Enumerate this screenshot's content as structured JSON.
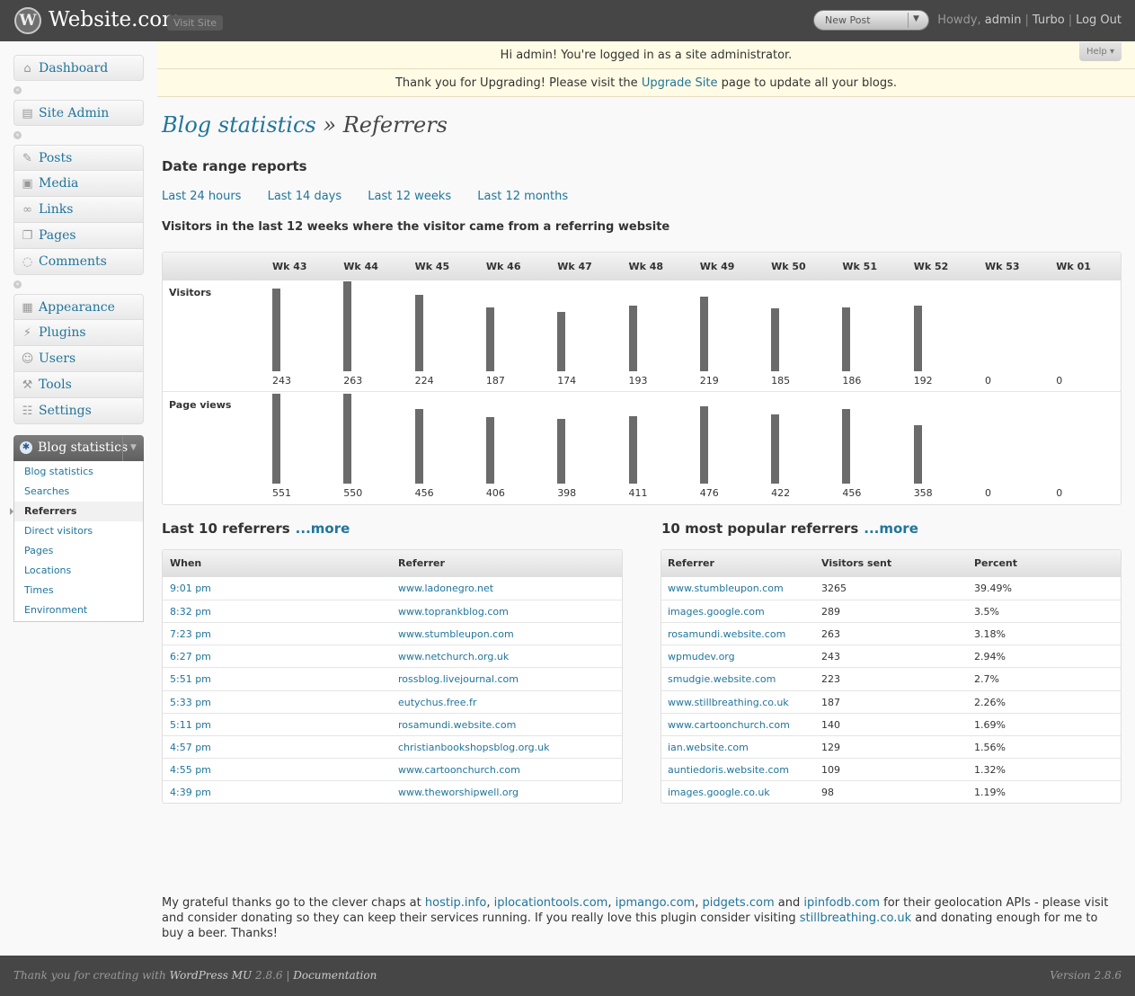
{
  "header": {
    "site_title": "Website.com",
    "visit_site": "Visit Site",
    "new_post": "New Post",
    "howdy": "Howdy,",
    "user": "admin",
    "turbo": "Turbo",
    "logout": "Log Out"
  },
  "notices": {
    "admin": "Hi admin! You're logged in as a site administrator.",
    "help": "Help",
    "upgrade_pre": "Thank you for Upgrading! Please visit the",
    "upgrade_link": "Upgrade Site",
    "upgrade_post": "page to update all your blogs."
  },
  "menu": {
    "dashboard": "Dashboard",
    "site_admin": "Site Admin",
    "posts": "Posts",
    "media": "Media",
    "links": "Links",
    "pages": "Pages",
    "comments": "Comments",
    "appearance": "Appearance",
    "plugins": "Plugins",
    "users": "Users",
    "tools": "Tools",
    "settings": "Settings",
    "blog_statistics": "Blog statistics",
    "submenu": [
      "Blog statistics",
      "Searches",
      "Referrers",
      "Direct visitors",
      "Pages",
      "Locations",
      "Times",
      "Environment"
    ]
  },
  "main": {
    "title_link": "Blog statistics",
    "title_rest": "» Referrers",
    "date_range_heading": "Date range reports",
    "ranges": [
      "Last 24 hours",
      "Last 14 days",
      "Last 12 weeks",
      "Last 12 months"
    ],
    "chart_heading": "Visitors in the last 12 weeks where the visitor came from a referring website"
  },
  "chart_data": {
    "type": "bar",
    "categories": [
      "Wk 43",
      "Wk 44",
      "Wk 45",
      "Wk 46",
      "Wk 47",
      "Wk 48",
      "Wk 49",
      "Wk 50",
      "Wk 51",
      "Wk 52",
      "Wk 53",
      "Wk 01"
    ],
    "series": [
      {
        "name": "Visitors",
        "values": [
          243,
          263,
          224,
          187,
          174,
          193,
          219,
          185,
          186,
          192,
          0,
          0
        ]
      },
      {
        "name": "Page views",
        "values": [
          551,
          550,
          456,
          406,
          398,
          411,
          476,
          422,
          456,
          358,
          0,
          0
        ]
      }
    ],
    "bar_color": "#6b6b6b"
  },
  "last_referrers": {
    "heading": "Last 10 referrers",
    "more": "...more",
    "headers": [
      "When",
      "Referrer"
    ],
    "rows": [
      [
        "9:01 pm",
        "www.ladonegro.net"
      ],
      [
        "8:32 pm",
        "www.toprankblog.com"
      ],
      [
        "7:23 pm",
        "www.stumbleupon.com"
      ],
      [
        "6:27 pm",
        "www.netchurch.org.uk"
      ],
      [
        "5:51 pm",
        "rossblog.livejournal.com"
      ],
      [
        "5:33 pm",
        "eutychus.free.fr"
      ],
      [
        "5:11 pm",
        "rosamundi.website.com"
      ],
      [
        "4:57 pm",
        "christianbookshopsblog.org.uk"
      ],
      [
        "4:55 pm",
        "www.cartoonchurch.com"
      ],
      [
        "4:39 pm",
        "www.theworshipwell.org"
      ]
    ]
  },
  "popular_referrers": {
    "heading": "10 most popular referrers",
    "more": "...more",
    "headers": [
      "Referrer",
      "Visitors sent",
      "Percent"
    ],
    "rows": [
      [
        "www.stumbleupon.com",
        "3265",
        "39.49%"
      ],
      [
        "images.google.com",
        "289",
        "3.5%"
      ],
      [
        "rosamundi.website.com",
        "263",
        "3.18%"
      ],
      [
        "wpmudev.org",
        "243",
        "2.94%"
      ],
      [
        "smudgie.website.com",
        "223",
        "2.7%"
      ],
      [
        "www.stillbreathing.co.uk",
        "187",
        "2.26%"
      ],
      [
        "www.cartoonchurch.com",
        "140",
        "1.69%"
      ],
      [
        "ian.website.com",
        "129",
        "1.56%"
      ],
      [
        "auntiedoris.website.com",
        "109",
        "1.32%"
      ],
      [
        "images.google.co.uk",
        "98",
        "1.19%"
      ]
    ]
  },
  "credits": {
    "t1": "My grateful thanks go to the clever chaps at",
    "l1": "hostip.info",
    "l2": "iplocationtools.com",
    "l3": "ipmango.com",
    "l4": "pidgets.com",
    "and": "and",
    "l5": "ipinfodb.com",
    "t2": "for their geolocation APIs - please visit and consider donating so they can keep their services running. If you really love this plugin consider visiting",
    "l6": "stillbreathing.co.uk",
    "t3": "and donating enough for me to buy a beer. Thanks!"
  },
  "footer": {
    "thanks_pre": "Thank you for creating with",
    "wp_link": "WordPress MU",
    "wp_version": "2.8.6",
    "documentation": "Documentation",
    "version": "Version 2.8.6"
  }
}
